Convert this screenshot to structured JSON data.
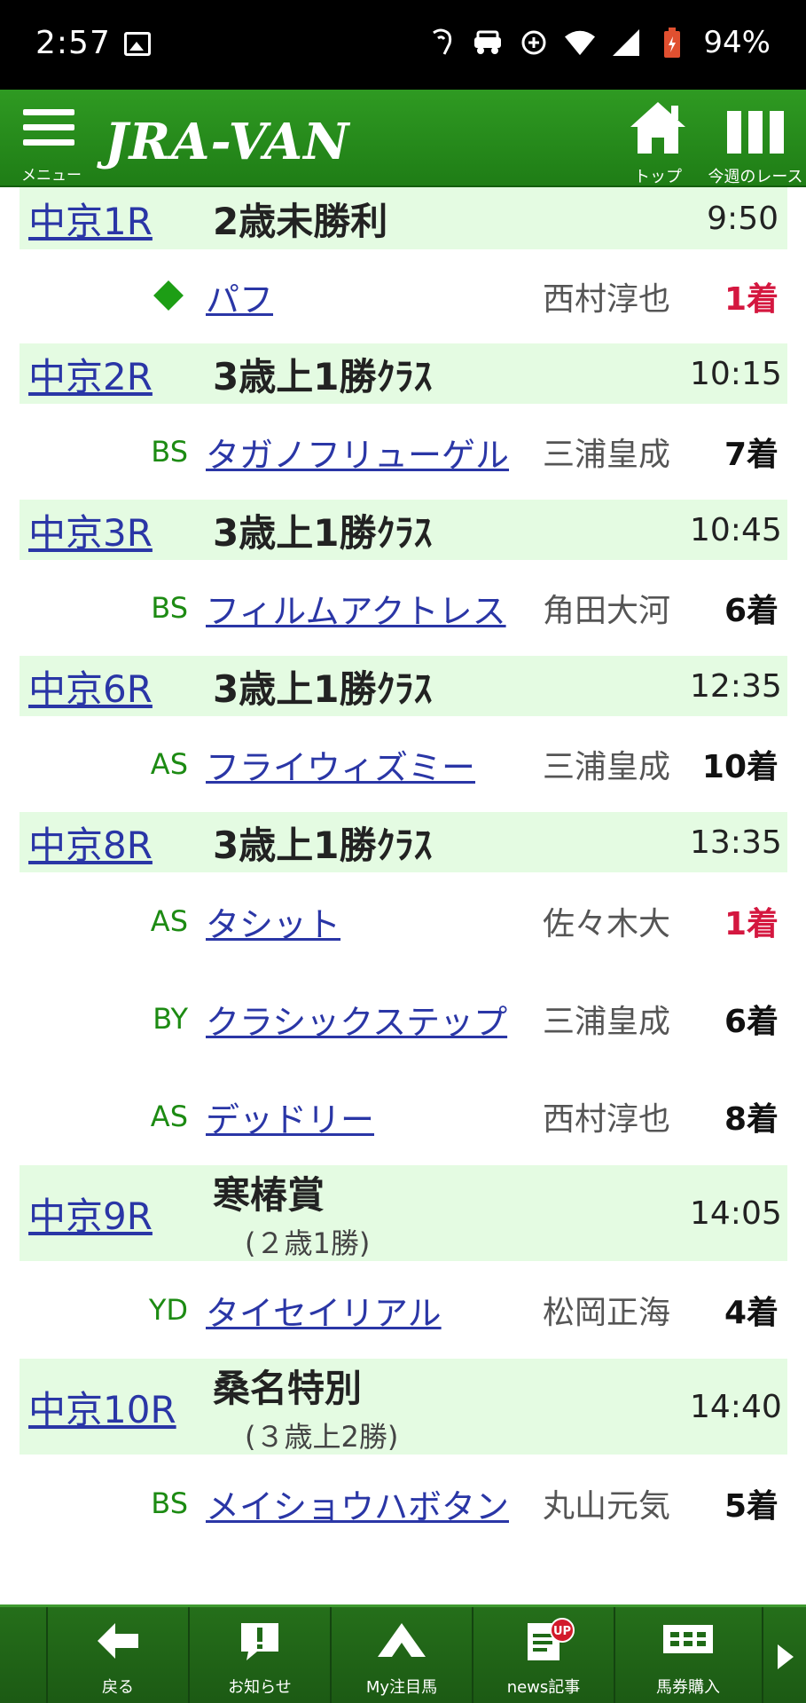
{
  "status_bar": {
    "time": "2:57",
    "battery": "94%"
  },
  "header": {
    "menu_label": "メニュー",
    "logo_text": "JRA-VAN",
    "home_label": "トップ",
    "week_label": "今週のレース"
  },
  "races": [
    {
      "race": "中京1R",
      "name": "2歳未勝利",
      "sub": "",
      "time": "9:50",
      "horses": [
        {
          "mark": "◆",
          "name": "パフ",
          "jockey": "西村淳也",
          "place": "1着",
          "win": true
        }
      ]
    },
    {
      "race": "中京2R",
      "name": "3歳上1勝ｸﾗｽ",
      "sub": "",
      "time": "10:15",
      "horses": [
        {
          "mark": "BS",
          "name": "タガノフリューゲル",
          "jockey": "三浦皇成",
          "place": "7着",
          "win": false
        }
      ]
    },
    {
      "race": "中京3R",
      "name": "3歳上1勝ｸﾗｽ",
      "sub": "",
      "time": "10:45",
      "horses": [
        {
          "mark": "BS",
          "name": "フィルムアクトレス",
          "jockey": "角田大河",
          "place": "6着",
          "win": false
        }
      ]
    },
    {
      "race": "中京6R",
      "name": "3歳上1勝ｸﾗｽ",
      "sub": "",
      "time": "12:35",
      "horses": [
        {
          "mark": "AS",
          "name": "フライウィズミー",
          "jockey": "三浦皇成",
          "place": "10着",
          "win": false
        }
      ]
    },
    {
      "race": "中京8R",
      "name": "3歳上1勝ｸﾗｽ",
      "sub": "",
      "time": "13:35",
      "horses": [
        {
          "mark": "AS",
          "name": "タシット",
          "jockey": "佐々木大",
          "place": "1着",
          "win": true
        },
        {
          "mark": "BY",
          "name": "クラシックステップ",
          "jockey": "三浦皇成",
          "place": "6着",
          "win": false
        },
        {
          "mark": "AS",
          "name": "デッドリー",
          "jockey": "西村淳也",
          "place": "8着",
          "win": false
        }
      ]
    },
    {
      "race": "中京9R",
      "name": "寒椿賞",
      "sub": "(２歳1勝)",
      "time": "14:05",
      "horses": [
        {
          "mark": "YD",
          "name": "タイセイリアル",
          "jockey": "松岡正海",
          "place": "4着",
          "win": false
        }
      ]
    },
    {
      "race": "中京10R",
      "name": "桑名特別",
      "sub": "(３歳上2勝)",
      "time": "14:40",
      "horses": [
        {
          "mark": "BS",
          "name": "メイショウハボタン",
          "jockey": "丸山元気",
          "place": "5着",
          "win": false
        }
      ]
    }
  ],
  "bottom_nav": [
    {
      "label": "戻る",
      "icon": "back-arrow-icon"
    },
    {
      "label": "お知らせ",
      "icon": "notice-icon"
    },
    {
      "label": "My注目馬",
      "icon": "my-horse-icon"
    },
    {
      "label": "news記事",
      "icon": "news-icon",
      "badge": "UP"
    },
    {
      "label": "馬券購入",
      "icon": "ticket-icon"
    }
  ],
  "colors": {
    "header_green": "#2f9a22",
    "race_row_bg": "#e4fbe2",
    "link_blue": "#2a36a6",
    "win_red": "#d4173f",
    "mark_green": "#1d8b13"
  }
}
